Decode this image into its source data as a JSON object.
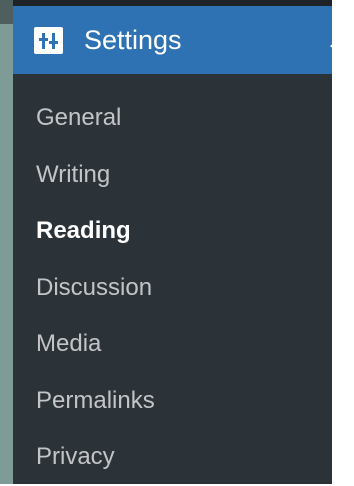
{
  "settings_menu": {
    "label": "Settings",
    "icon": "sliders-icon",
    "submenu": [
      {
        "label": "General",
        "current": false
      },
      {
        "label": "Writing",
        "current": false
      },
      {
        "label": "Reading",
        "current": true
      },
      {
        "label": "Discussion",
        "current": false
      },
      {
        "label": "Media",
        "current": false
      },
      {
        "label": "Permalinks",
        "current": false
      },
      {
        "label": "Privacy",
        "current": false
      }
    ]
  },
  "colors": {
    "sidebar_background": "#2c3338",
    "active_header": "#2f72b3",
    "submenu_text": "#c3c4c7",
    "current_text": "#ffffff"
  }
}
